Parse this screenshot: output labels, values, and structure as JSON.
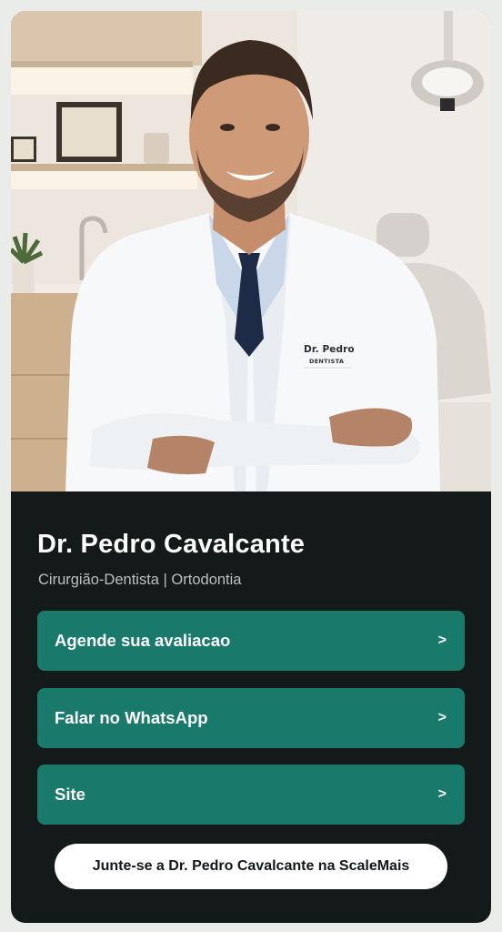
{
  "profile": {
    "name": "Dr. Pedro Cavalcante",
    "subtitle": "Cirurgião-Dentista | Ortodontia",
    "coat_name": "Dr. Pedro",
    "coat_role": "DENTISTA"
  },
  "links": [
    {
      "label": "Agende sua avaliacao",
      "chevron": ">"
    },
    {
      "label": "Falar no WhatsApp",
      "chevron": ">"
    },
    {
      "label": "Site",
      "chevron": ">"
    }
  ],
  "join_label": "Junte-se a Dr. Pedro Cavalcante na ScaleMais",
  "colors": {
    "card_bg": "#141a19",
    "button_bg": "#197a6c",
    "page_bg": "#e9ece9"
  }
}
